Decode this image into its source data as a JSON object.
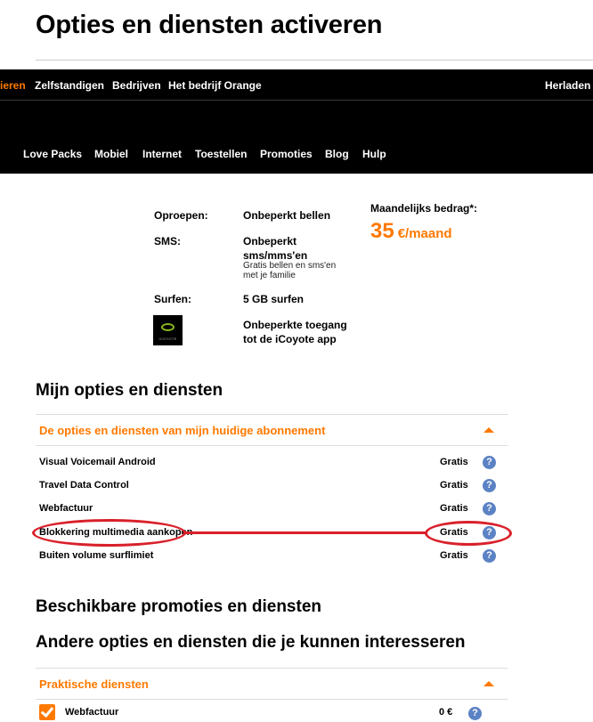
{
  "page": {
    "title": "Opties en diensten activeren"
  },
  "top_nav": {
    "items": [
      "ieren",
      "Zelfstandigen",
      "Bedrijven",
      "Het bedrijf Orange"
    ],
    "right": "Herladen"
  },
  "main_nav": {
    "items": [
      "Love Packs",
      "Mobiel",
      "Internet",
      "Toestellen",
      "Promoties",
      "Blog",
      "Hulp"
    ]
  },
  "plan": {
    "calls_label": "Oproepen:",
    "calls_value": "Onbeperkt bellen",
    "sms_label": "SMS:",
    "sms_value": "Onbeperkt sms/mms'en",
    "sms_note": "Gratis bellen en sms'en met je familie",
    "data_label": "Surfen:",
    "data_value": "5 GB surfen",
    "app_value": "Onbeperkte toegang tot de iCoyote app",
    "app_logo_text": "ICOYOTE",
    "amount_label": "Maandelijks bedrag*:",
    "amount_number": "35",
    "amount_unit": "€/maand"
  },
  "my_options": {
    "title": "Mijn opties en diensten",
    "accordion_label": "De opties en diensten van mijn huidige abonnement",
    "items": [
      {
        "name": "Visual Voicemail Android",
        "price": "Gratis"
      },
      {
        "name": "Travel Data Control",
        "price": "Gratis"
      },
      {
        "name": "Webfactuur",
        "price": "Gratis"
      },
      {
        "name": "Blokkering multimedia aankopen",
        "price": "Gratis"
      },
      {
        "name": "Buiten volume surflimiet",
        "price": "Gratis"
      }
    ]
  },
  "available": {
    "title": "Beschikbare promoties en diensten"
  },
  "other": {
    "title": "Andere opties en diensten die je kunnen interesseren",
    "accordion_label": "Praktische diensten",
    "items": [
      {
        "name": "Webfactuur",
        "price": "0 €",
        "checked": true
      }
    ]
  },
  "icons": {
    "help": "?"
  },
  "colors": {
    "accent": "#ff7900",
    "highlight": "#d9202a",
    "help": "#5b82c4"
  }
}
